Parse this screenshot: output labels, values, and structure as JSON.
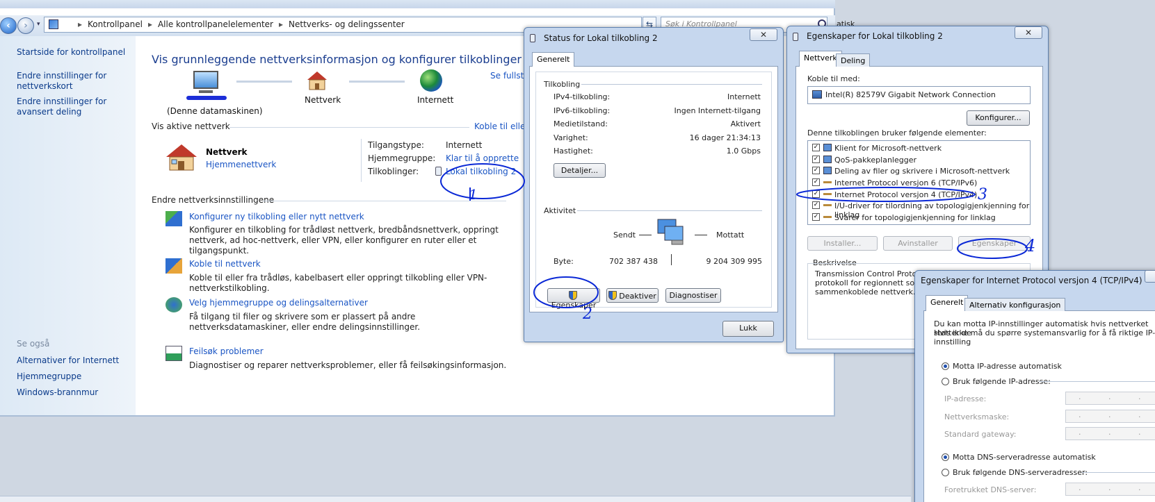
{
  "explorer": {
    "breadcrumb": [
      "Kontrollpanel",
      "Alle kontrollpanelelementer",
      "Nettverks- og delingssenter"
    ],
    "search_placeholder": "Søk i Kontrollpanel",
    "sidebar": {
      "items": [
        "Startside for kontrollpanel",
        "Endre innstillinger for nettverkskort",
        "Endre innstillinger for avansert deling"
      ],
      "see_also_label": "Se også",
      "see_also": [
        "Alternativer for Internett",
        "Hjemmegruppe",
        "Windows-brannmur"
      ]
    },
    "title": "Vis grunnleggende nettverksinformasjon og konfigurer tilkoblinger",
    "fullscreen_link": "Se fullst",
    "map": {
      "computer": "(Denne datamaskinen)",
      "network": "Nettverk",
      "internet": "Internett"
    },
    "active_header": "Vis aktive nettverk",
    "connect_link": "Koble til eller",
    "network": {
      "name": "Nettverk",
      "type_link": "Hjemmenettverk",
      "access_type_label": "Tilgangstype:",
      "access_type_value": "Internett",
      "homegroup_label": "Hjemmegruppe:",
      "homegroup_link": "Klar til å opprette",
      "connections_label": "Tilkoblinger:",
      "connection_link": "Lokal tilkobling 2"
    },
    "settings_header": "Endre nettverksinnstillingene",
    "tasks": [
      {
        "title": "Konfigurer ny tilkobling eller nytt nettverk",
        "desc": "Konfigurer en tilkobling for trådløst nettverk, bredbåndsnettverk, oppringt nettverk, ad hoc-nettverk, eller VPN, eller konfigurer en ruter eller et tilgangspunkt."
      },
      {
        "title": "Koble til nettverk",
        "desc": "Koble til eller fra trådløs, kabelbasert eller oppringt tilkobling eller VPN-nettverkstilkobling."
      },
      {
        "title": "Velg hjemmegruppe og delingsalternativer",
        "desc": "Få tilgang til filer og skrivere som er plassert på andre nettverksdatamaskiner, eller endre delingsinnstillinger."
      },
      {
        "title": "Feilsøk problemer",
        "desc": "Diagnostiser og reparer nettverksproblemer, eller få feilsøkingsinformasjon."
      }
    ],
    "peek_right": "atisk"
  },
  "status_dialog": {
    "title": "Status for Lokal tilkobling 2",
    "tab": "Generelt",
    "connection_header": "Tilkobling",
    "rows": [
      {
        "label": "IPv4-tilkobling:",
        "value": "Internett"
      },
      {
        "label": "IPv6-tilkobling:",
        "value": "Ingen Internett-tilgang"
      },
      {
        "label": "Medietilstand:",
        "value": "Aktivert"
      },
      {
        "label": "Varighet:",
        "value": "16 dager 21:34:13"
      },
      {
        "label": "Hastighet:",
        "value": "1.0 Gbps"
      }
    ],
    "details_button": "Detaljer...",
    "activity_header": "Aktivitet",
    "sent_label": "Sendt",
    "received_label": "Mottatt",
    "bytes_label": "Byte:",
    "bytes_sent": "702 387 438",
    "bytes_received": "9 204 309 995",
    "properties_button": "Egenskaper",
    "disable_button": "Deaktiver",
    "diagnose_button": "Diagnostiser",
    "close_button": "Lukk"
  },
  "props_dialog": {
    "title": "Egenskaper for Lokal tilkobling 2",
    "tabs": [
      "Nettverk",
      "Deling"
    ],
    "connect_using_label": "Koble til med:",
    "adapter": "Intel(R) 82579V Gigabit Network Connection",
    "configure_button": "Konfigurer...",
    "items_label": "Denne tilkoblingen bruker følgende elementer:",
    "items": [
      "Klient for Microsoft-nettverk",
      "QoS-pakkeplanlegger",
      "Deling av filer og skrivere i Microsoft-nettverk",
      "Internet Protocol versjon 6 (TCP/IPv6)",
      "Internet Protocol versjon 4 (TCP/IPv4)",
      "I/U-driver for tilordning av topologigjenkjenning for linklag",
      "Svarer for topologigjenkjenning for linklag"
    ],
    "install_button": "Installer...",
    "uninstall_button": "Avinstaller",
    "properties_button": "Egenskaper",
    "description_label": "Beskrivelse",
    "description_lines": [
      "Transmission Control Protocol",
      "protokoll for regionnett som tilla",
      "sammenkoblede nettverk."
    ]
  },
  "ipv4_dialog": {
    "title": "Egenskaper for Internet Protocol versjon 4 (TCP/IPv4)",
    "tabs": [
      "Generelt",
      "Alternativ konfigurasjon"
    ],
    "intro_line1": "Du kan motta IP-innstillinger automatisk hvis nettverket støtter de",
    "intro_line2": "Hvis ikke må du spørre systemansvarlig for å få riktige IP-innstilling",
    "auto_ip": "Motta IP-adresse automatisk",
    "manual_ip": "Bruk følgende IP-adresse:",
    "ip_label": "IP-adresse:",
    "mask_label": "Nettverksmaske:",
    "gateway_label": "Standard gateway:",
    "auto_dns": "Motta DNS-serveradresse automatisk",
    "manual_dns": "Bruk følgende DNS-serveradresser:",
    "preferred_dns_label": "Foretrukket DNS-server:",
    "ip_placeholder": ". . ."
  },
  "annotations": [
    "1",
    "2",
    "3",
    "4"
  ]
}
